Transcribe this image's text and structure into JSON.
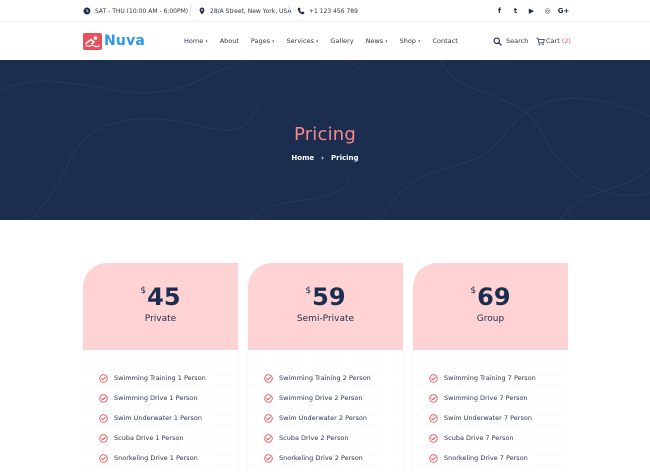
{
  "topbar": {
    "hours": "SAT - THU (10:00 AM - 6:00PM)",
    "address": "28/A Street, New York, USA",
    "phone": "+1 123 456 789",
    "social_icons": [
      "facebook-icon",
      "twitter-icon",
      "youtube-icon",
      "instagram-icon",
      "google-plus-icon"
    ],
    "social_glyphs": [
      "f",
      "t",
      "▶",
      "◎",
      "G+"
    ]
  },
  "header": {
    "logo_text": "Nuva",
    "nav": [
      {
        "label": "Home",
        "has_dropdown": true
      },
      {
        "label": "About",
        "has_dropdown": false
      },
      {
        "label": "Pages",
        "has_dropdown": true
      },
      {
        "label": "Services",
        "has_dropdown": true
      },
      {
        "label": "Gallery",
        "has_dropdown": false
      },
      {
        "label": "News",
        "has_dropdown": true
      },
      {
        "label": "Shop",
        "has_dropdown": true
      },
      {
        "label": "Contact",
        "has_dropdown": false
      }
    ],
    "search_label": "Search",
    "cart_label": "Cart",
    "cart_count": "(2)"
  },
  "hero": {
    "title": "Pricing",
    "breadcrumb_home": "Home",
    "breadcrumb_current": "Pricing"
  },
  "colors": {
    "accent": "#e8515a",
    "brand_blue": "#2f97ea",
    "hero_bg": "#1b2e4f",
    "card_head": "#ffd2d3",
    "hero_title": "#f7898c"
  },
  "pricing": [
    {
      "currency": "$",
      "price": "45",
      "plan": "Private",
      "features": [
        "Swimming Training 1 Person",
        "Swimming Drive 1 Person",
        "Swim Underwater 1 Person",
        "Scuba Drive 1 Person",
        "Snorkeling Drive 1 Person"
      ]
    },
    {
      "currency": "$",
      "price": "59",
      "plan": "Semi-Private",
      "features": [
        "Swimming Training 2 Person",
        "Swimming Drive 2 Person",
        "Swim Underwater 2 Person",
        "Scuba Drive 2 Person",
        "Snorkeling Drive 2 Person"
      ]
    },
    {
      "currency": "$",
      "price": "69",
      "plan": "Group",
      "features": [
        "Swimming Training 7 Person",
        "Swimming Drive 7 Person",
        "Swim Underwater 7 Person",
        "Scuba Drive 7 Person",
        "Snorkeling Drive 7 Person"
      ]
    }
  ]
}
